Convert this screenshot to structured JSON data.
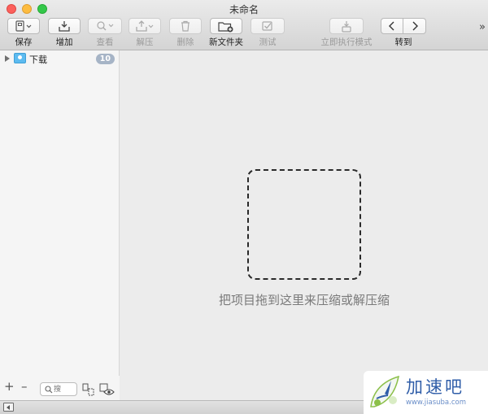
{
  "window": {
    "title": "未命名"
  },
  "toolbar": {
    "save": "保存",
    "add": "增加",
    "view": "查看",
    "extract": "解压",
    "delete": "删除",
    "new_folder": "新文件夹",
    "test": "测试",
    "instant_mode": "立即执行模式",
    "goto": "转到",
    "overflow": "»"
  },
  "sidebar": {
    "items": [
      {
        "label": "下载",
        "count": "10"
      }
    ],
    "footer": {
      "add": "+",
      "remove": "–",
      "search_placeholder": "搜"
    }
  },
  "main": {
    "drop_hint": "把项目拖到这里来压缩或解压缩"
  },
  "watermark": {
    "name": "加速吧",
    "url": "www.jiasuba.com"
  },
  "colors": {
    "badge": "#a6b4c6",
    "folder": "#5dbbf0",
    "watermark_text": "#2f5da8"
  }
}
